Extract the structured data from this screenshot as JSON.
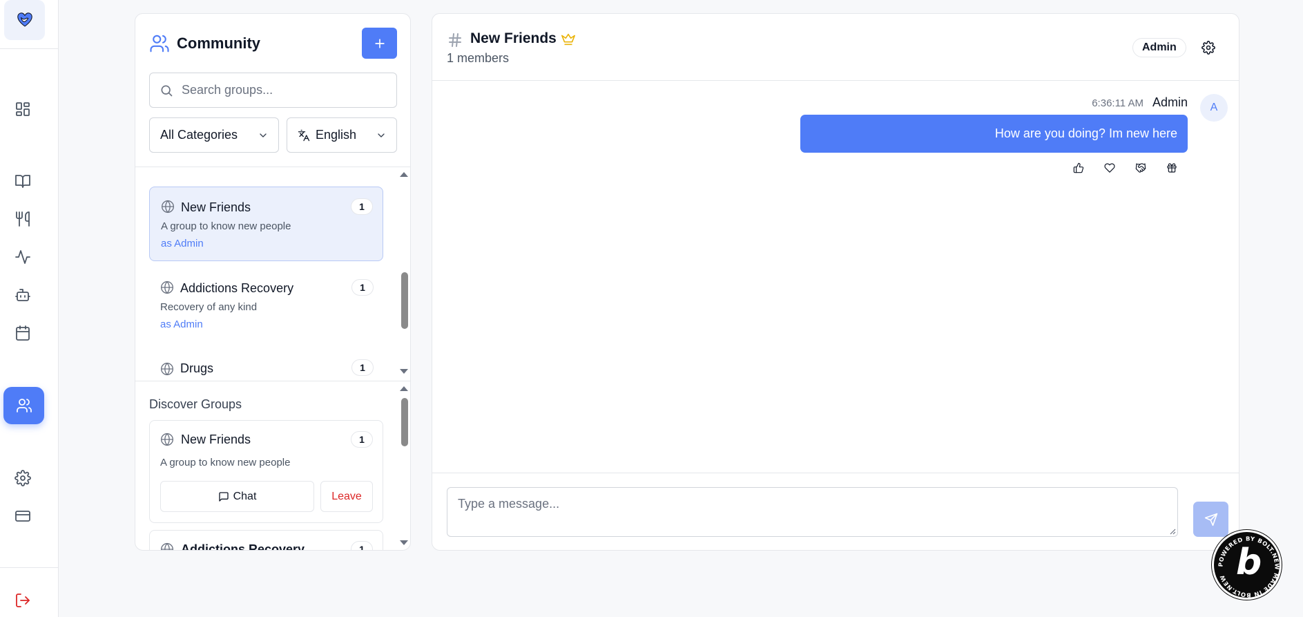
{
  "rail": {
    "logo_icon": "heart-bird-logo",
    "items": [
      {
        "name": "dashboard",
        "icon": "grid-icon"
      },
      {
        "name": "journal",
        "icon": "book-open-icon"
      },
      {
        "name": "nutrition",
        "icon": "utensils-icon"
      },
      {
        "name": "activity",
        "icon": "activity-icon"
      },
      {
        "name": "assistant",
        "icon": "bot-icon"
      },
      {
        "name": "calendar",
        "icon": "calendar-icon"
      },
      {
        "name": "community",
        "icon": "users-icon",
        "active": true
      },
      {
        "name": "settings",
        "icon": "gear-icon"
      },
      {
        "name": "billing",
        "icon": "credit-card-icon"
      },
      {
        "name": "logout",
        "icon": "logout-icon"
      }
    ]
  },
  "community": {
    "title": "Community",
    "add_icon": "plus-icon",
    "search_placeholder": "Search groups...",
    "category_select": "All Categories",
    "language_select": "English"
  },
  "my_groups": [
    {
      "name": "New Friends",
      "count": "1",
      "description": "A group to know new people",
      "role": "as Admin",
      "selected": true
    },
    {
      "name": "Addictions Recovery",
      "count": "1",
      "description": "Recovery of any kind",
      "role": "as Admin",
      "selected": false
    },
    {
      "name": "Drugs",
      "count": "1"
    }
  ],
  "discover": {
    "title": "Discover Groups",
    "groups": [
      {
        "name": "New Friends",
        "count": "1",
        "description": "A group to know new people",
        "chat_label": "Chat",
        "leave_label": "Leave"
      },
      {
        "name": "Addictions Recovery",
        "count": "1"
      }
    ]
  },
  "chat": {
    "channel_name": "New Friends",
    "members": "1 members",
    "role_badge": "Admin",
    "messages": [
      {
        "time": "6:36:11 AM",
        "author": "Admin",
        "avatar": "A",
        "text": "How are you doing? Im new here",
        "reactions": [
          "thumbs-up-icon",
          "heart-icon",
          "handshake-icon",
          "gift-icon"
        ]
      }
    ],
    "composer_placeholder": "Type a message..."
  },
  "colors": {
    "accent": "#4f7cf7",
    "accent_soft": "#ebf0fc",
    "danger": "#dc2626",
    "crown": "#eab308"
  },
  "badge": {
    "ring_text": "POWERED BY BOLT.NEW MADE IN BOLT.NEW",
    "glyph": "b"
  }
}
